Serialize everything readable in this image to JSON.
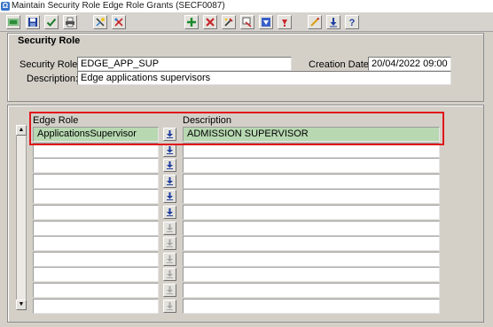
{
  "window": {
    "title": "Maintain Security Role Edge Role Grants (SECF0087)",
    "icon_text": "Ω"
  },
  "toolbar": {
    "buttons": [
      {
        "name": "exit-icon",
        "label": "EXIT"
      },
      {
        "name": "save-icon"
      },
      {
        "name": "accept-icon"
      },
      {
        "name": "print-icon"
      },
      {
        "name": "enter-query-icon"
      },
      {
        "name": "cancel-query-icon"
      },
      {
        "name": "insert-record-icon"
      },
      {
        "name": "delete-record-icon"
      },
      {
        "name": "clear-record-icon"
      },
      {
        "name": "duplicate-record-icon"
      },
      {
        "name": "previous-record-icon"
      },
      {
        "name": "next-record-icon"
      },
      {
        "name": "edit-icon"
      },
      {
        "name": "list-values-icon"
      },
      {
        "name": "help-icon"
      }
    ]
  },
  "security_role": {
    "section_title": "Security Role",
    "role_label": "Security Role:",
    "role_value": "EDGE_APP_SUP",
    "creation_date_label": "Creation Date:",
    "creation_date_value": "20/04/2022 09:00",
    "description_label": "Description:",
    "description_value": "Edge applications supervisors"
  },
  "grants": {
    "edge_role_header": "Edge Role",
    "description_header": "Description",
    "rows": [
      {
        "edge_role": "ApplicationsSupervisor",
        "description": "ADMISSION SUPERVISOR",
        "selected": true,
        "lov_enabled": true
      },
      {
        "edge_role": "",
        "description": "",
        "selected": false,
        "lov_enabled": true
      },
      {
        "edge_role": "",
        "description": "",
        "selected": false,
        "lov_enabled": true
      },
      {
        "edge_role": "",
        "description": "",
        "selected": false,
        "lov_enabled": true
      },
      {
        "edge_role": "",
        "description": "",
        "selected": false,
        "lov_enabled": true
      },
      {
        "edge_role": "",
        "description": "",
        "selected": false,
        "lov_enabled": true
      },
      {
        "edge_role": "",
        "description": "",
        "selected": false,
        "lov_enabled": false
      },
      {
        "edge_role": "",
        "description": "",
        "selected": false,
        "lov_enabled": false
      },
      {
        "edge_role": "",
        "description": "",
        "selected": false,
        "lov_enabled": false
      },
      {
        "edge_role": "",
        "description": "",
        "selected": false,
        "lov_enabled": false
      },
      {
        "edge_role": "",
        "description": "",
        "selected": false,
        "lov_enabled": false
      },
      {
        "edge_role": "",
        "description": "",
        "selected": false,
        "lov_enabled": false
      }
    ]
  },
  "colors": {
    "selected_row": "#b7d8b1",
    "highlight_border": "#e0161b",
    "form_background": "#d4d0c8"
  }
}
